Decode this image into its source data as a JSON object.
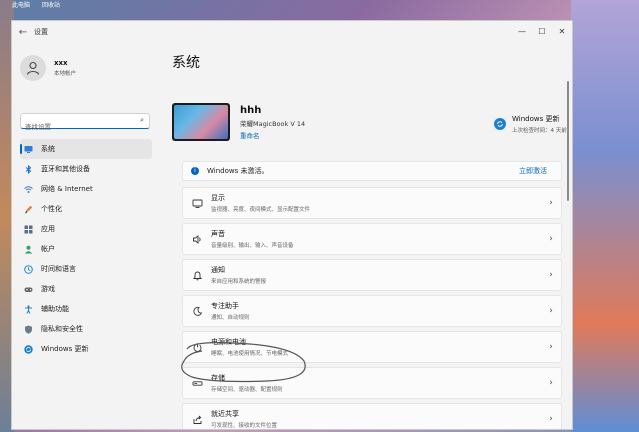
{
  "desktop": {
    "icon1": "此电脑",
    "icon2": "回收站"
  },
  "window": {
    "title": "设置",
    "controls": {
      "minimize": "—",
      "maximize": "☐",
      "close": "✕"
    }
  },
  "user": {
    "name": "xxx",
    "account_type": "本地帐户"
  },
  "search": {
    "placeholder": "查找设置"
  },
  "nav": [
    {
      "label": "系统",
      "icon": "monitor-icon",
      "active": true
    },
    {
      "label": "蓝牙和其他设备",
      "icon": "bluetooth-icon"
    },
    {
      "label": "网络 & Internet",
      "icon": "wifi-icon"
    },
    {
      "label": "个性化",
      "icon": "brush-icon"
    },
    {
      "label": "应用",
      "icon": "apps-icon"
    },
    {
      "label": "帐户",
      "icon": "person-icon"
    },
    {
      "label": "时间和语言",
      "icon": "globe-clock-icon"
    },
    {
      "label": "游戏",
      "icon": "gamepad-icon"
    },
    {
      "label": "辅助功能",
      "icon": "accessibility-icon"
    },
    {
      "label": "隐私和安全性",
      "icon": "shield-icon"
    },
    {
      "label": "Windows 更新",
      "icon": "windows-update-icon"
    }
  ],
  "main": {
    "title": "系统",
    "device": {
      "name": "hhh",
      "model": "荣耀MagicBook V 14",
      "rename": "重命名"
    },
    "windows_update": {
      "title": "Windows 更新",
      "subtitle": "上次检查时间：4 天前"
    },
    "activation": {
      "text": "Windows 未激活。",
      "link": "立即激活"
    },
    "cards": [
      {
        "title": "显示",
        "subtitle": "监视器、亮度、夜间模式、显示配置文件",
        "icon": "display-icon"
      },
      {
        "title": "声音",
        "subtitle": "音量级别、输出、输入、声音设备",
        "icon": "speaker-icon"
      },
      {
        "title": "通知",
        "subtitle": "来自应用和系统的警报",
        "icon": "bell-icon"
      },
      {
        "title": "专注助手",
        "subtitle": "通知、自动规则",
        "icon": "moon-icon"
      },
      {
        "title": "电源和电池",
        "subtitle": "睡眠、电池使用情况、节电模式",
        "icon": "power-icon"
      },
      {
        "title": "存储",
        "subtitle": "存储空间、驱动器、配置规则",
        "icon": "storage-icon"
      },
      {
        "title": "就近共享",
        "subtitle": "可发现性、接收的文件位置",
        "icon": "share-icon"
      }
    ]
  },
  "colors": {
    "accent": "#0067c0",
    "background": "#f3f3f3",
    "card": "#fbfbfb"
  }
}
